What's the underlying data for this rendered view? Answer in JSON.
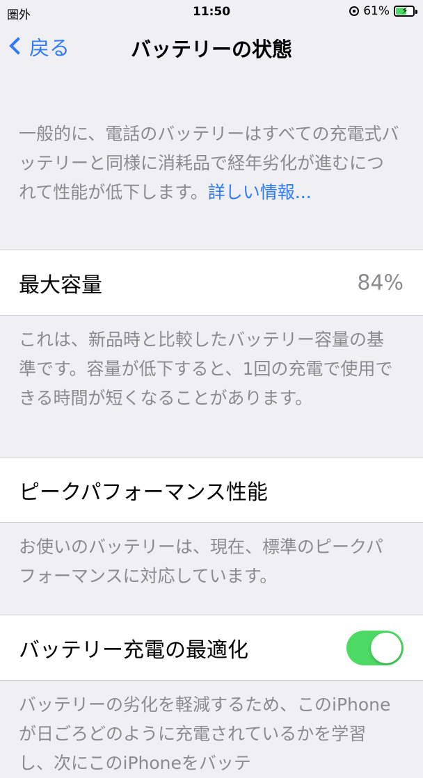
{
  "status": {
    "carrier": "圏外",
    "time": "11:50",
    "battery_percent": "61%",
    "battery_level": 0.61
  },
  "nav": {
    "back_label": "戻る",
    "title": "バッテリーの状態"
  },
  "intro": {
    "text": "一般的に、電話のバッテリーはすべての充電式バッテリーと同様に消耗品で経年劣化が進むにつれて性能が低下します。",
    "learn_more": "詳しい情報..."
  },
  "max_capacity": {
    "label": "最大容量",
    "value": "84%",
    "footer": "これは、新品時と比較したバッテリー容量の基準です。容量が低下すると、1回の充電で使用できる時間が短くなることがあります。"
  },
  "peak_performance": {
    "label": "ピークパフォーマンス性能",
    "footer": "お使いのバッテリーは、現在、標準のピークパフォーマンスに対応しています。"
  },
  "optimized_charging": {
    "label": "バッテリー充電の最適化",
    "enabled": true,
    "footer": "バッテリーの劣化を軽減するため、このiPhoneが日ごろどのように充電されているかを学習し、次にこのiPhoneをバッテ"
  },
  "colors": {
    "accent": "#2f7cf6",
    "toggle_on": "#4cd964",
    "background": "#efeff4",
    "secondary_text": "#8a8a8f"
  }
}
